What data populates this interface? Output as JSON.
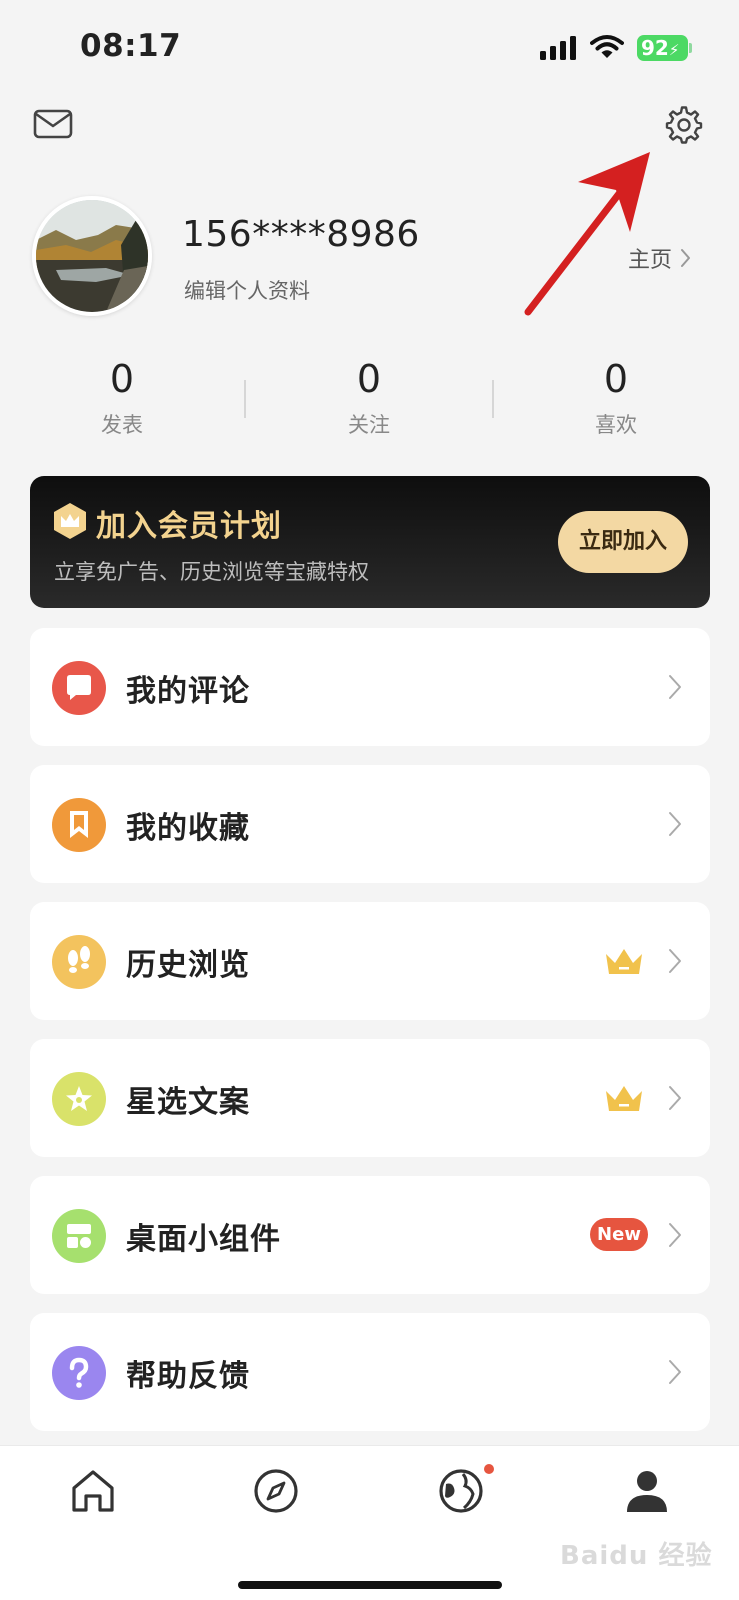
{
  "status_bar": {
    "time": "08:17",
    "battery": "92"
  },
  "profile": {
    "username": "156****8986",
    "edit_label": "编辑个人资料",
    "homepage_label": "主页"
  },
  "stats": [
    {
      "count": "0",
      "label": "发表"
    },
    {
      "count": "0",
      "label": "关注"
    },
    {
      "count": "0",
      "label": "喜欢"
    }
  ],
  "vip": {
    "title": "加入会员计划",
    "subtitle": "立享免广告、历史浏览等宝藏特权",
    "button": "立即加入"
  },
  "menu": [
    {
      "label": "我的评论",
      "icon": "comment-icon",
      "color": "#e8574a"
    },
    {
      "label": "我的收藏",
      "icon": "bookmark-icon",
      "color": "#f0993a"
    },
    {
      "label": "历史浏览",
      "icon": "footprints-icon",
      "color": "#f3c35e",
      "badge": "crown"
    },
    {
      "label": "星选文案",
      "icon": "star-icon",
      "color": "#d9e26a",
      "badge": "crown"
    },
    {
      "label": "桌面小组件",
      "icon": "widget-icon",
      "color": "#a6e06e",
      "badge": "New"
    },
    {
      "label": "帮助反馈",
      "icon": "question-icon",
      "color": "#9a86ef"
    }
  ],
  "bottom_nav": [
    {
      "name": "home-icon"
    },
    {
      "name": "compass-icon"
    },
    {
      "name": "globe-icon"
    },
    {
      "name": "profile-icon"
    }
  ],
  "watermark": "Baidu 经验",
  "colors": {
    "vip_gold": "#f3d38f",
    "new_badge": "#e6553f",
    "arrow": "#d42020"
  }
}
